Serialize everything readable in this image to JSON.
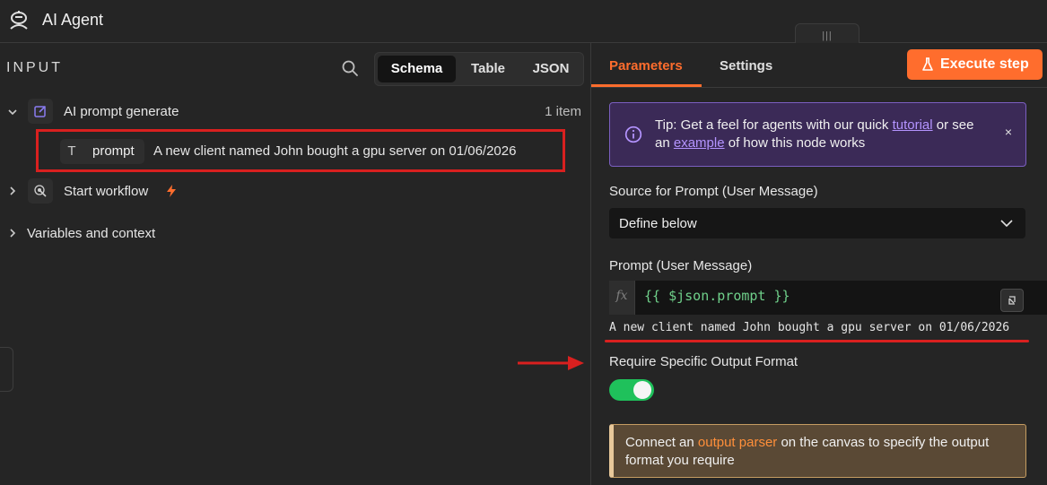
{
  "header": {
    "title": "AI Agent",
    "icon": "robot-icon",
    "drag_handle": "|||"
  },
  "input_panel": {
    "heading": "INPUT",
    "view_tabs": [
      "Schema",
      "Table",
      "JSON"
    ],
    "selected_tab": "Schema",
    "nodes": [
      {
        "label": "AI prompt generate",
        "count": "1 item",
        "expanded": true,
        "fields": [
          {
            "type_glyph": "T",
            "name": "prompt",
            "value": "A new client named John bought a gpu server on 01/06/2026"
          }
        ]
      },
      {
        "label": "Start workflow",
        "expanded": false
      },
      {
        "label": "Variables and context",
        "expanded": false
      }
    ]
  },
  "params_panel": {
    "tabs": [
      "Parameters",
      "Settings"
    ],
    "active_tab": "Parameters",
    "execute_label": "Execute step",
    "tip": {
      "part1": "Tip: Get a feel for agents with our quick ",
      "link1": "tutorial",
      "part2": " or see an ",
      "link2": "example",
      "part3": " of how this node works",
      "close": "×"
    },
    "source_label": "Source for Prompt (User Message)",
    "source_value": "Define below",
    "prompt_label": "Prompt (User Message)",
    "fx": "fx",
    "expression": "{{ $json.prompt }}",
    "expression_result": "A new client named John bought a gpu server on 01/06/2026",
    "output_format_label": "Require Specific Output Format",
    "output_format_enabled": true,
    "parser_notice": {
      "part1": "Connect an ",
      "link": "output parser",
      "part2": " on the canvas to specify the output format you require"
    }
  },
  "colors": {
    "accent": "#ff6d2d",
    "toggle_on": "#1fc15b",
    "highlight_red": "#d9201f",
    "tip_link": "#b494ff"
  }
}
